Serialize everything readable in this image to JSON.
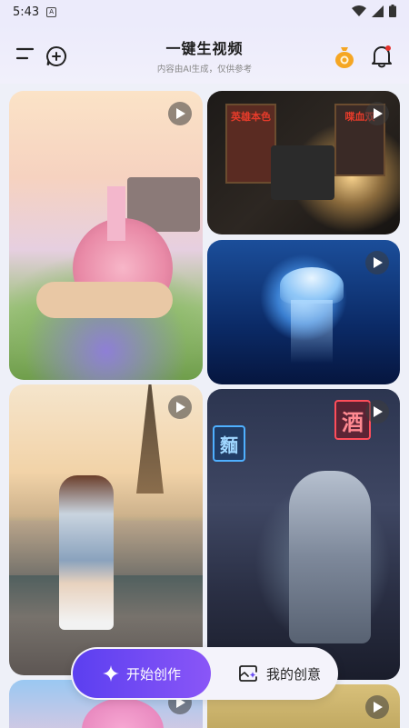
{
  "status_bar": {
    "time": "5:43",
    "sim_label": "A"
  },
  "header": {
    "title": "一键生视频",
    "subtitle": "内容由AI生成，仅供参考"
  },
  "feed": {
    "cards": [
      {
        "name": "snail-castle"
      },
      {
        "name": "projector-cinema",
        "poster_left": "英雄本色",
        "poster_right": "喋血双"
      },
      {
        "name": "jellyfish"
      },
      {
        "name": "eiffel-girl"
      },
      {
        "name": "robot-alley",
        "sign_top": "酒",
        "sign_left": "麵"
      },
      {
        "name": "anime-girl"
      },
      {
        "name": "golden-scene"
      }
    ]
  },
  "bottom_bar": {
    "start_label": "开始创作",
    "my_label": "我的创意"
  },
  "colors": {
    "accent_start": "#5b3ff0",
    "accent_end": "#8a56f7",
    "coin": "#f5a623",
    "notify_dot": "#e5322d"
  }
}
